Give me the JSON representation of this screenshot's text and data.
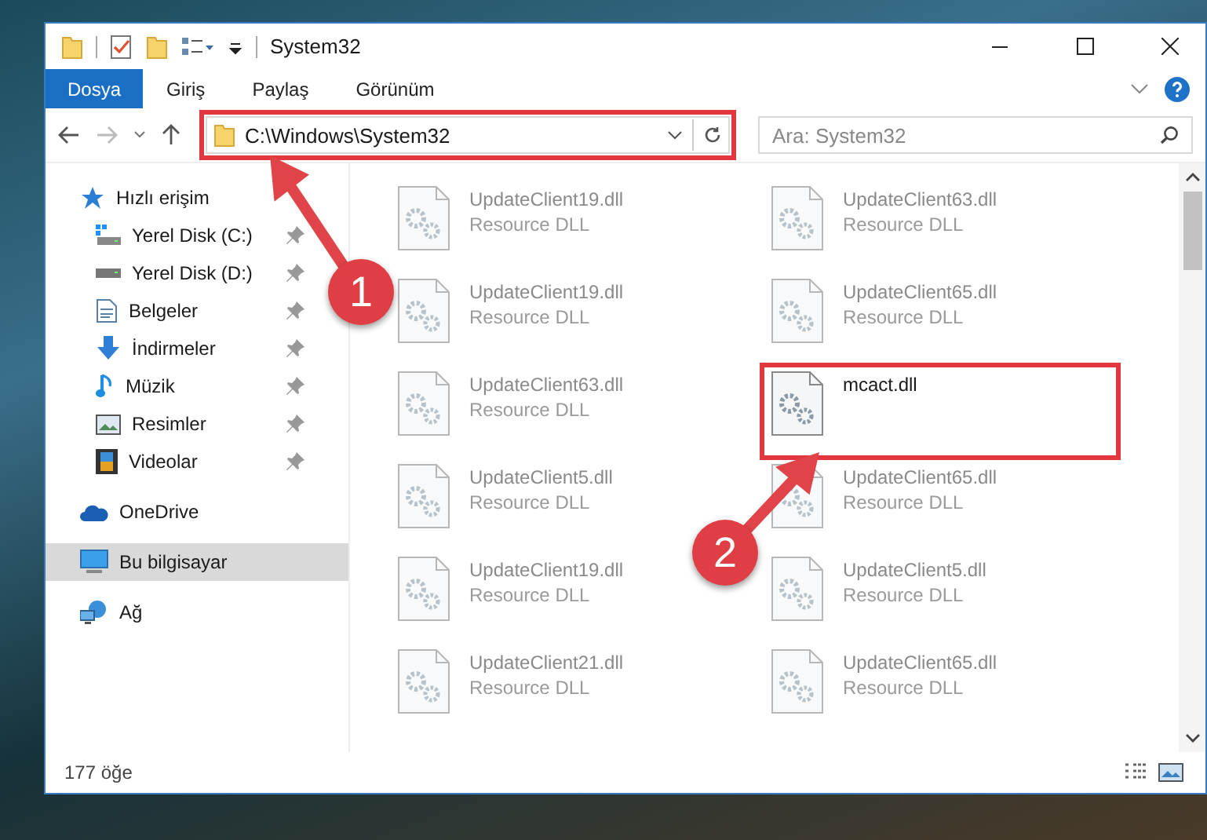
{
  "window": {
    "title": "System32"
  },
  "ribbon_tabs": [
    {
      "label": "Dosya",
      "selected": true
    },
    {
      "label": "Giriş",
      "selected": false
    },
    {
      "label": "Paylaş",
      "selected": false
    },
    {
      "label": "Görünüm",
      "selected": false
    }
  ],
  "address": {
    "path": "C:\\Windows\\System32",
    "highlighted": true
  },
  "search": {
    "placeholder": "Ara: System32"
  },
  "sidebar": {
    "items": [
      {
        "label": "Hızlı erişim",
        "kind": "star",
        "selected": false,
        "children": [
          {
            "label": "Yerel Disk (C:)",
            "kind": "drive-c",
            "pinned": true
          },
          {
            "label": "Yerel Disk (D:)",
            "kind": "drive",
            "pinned": true
          },
          {
            "label": "Belgeler",
            "kind": "docs",
            "pinned": true
          },
          {
            "label": "İndirmeler",
            "kind": "download",
            "pinned": true
          },
          {
            "label": "Müzik",
            "kind": "music",
            "pinned": true
          },
          {
            "label": "Resimler",
            "kind": "pictures",
            "pinned": true
          },
          {
            "label": "Videolar",
            "kind": "videos",
            "pinned": true
          }
        ]
      },
      {
        "label": "OneDrive",
        "kind": "cloud",
        "selected": false
      },
      {
        "label": "Bu bilgisayar",
        "kind": "pc",
        "selected": true
      },
      {
        "label": "Ağ",
        "kind": "network",
        "selected": false
      }
    ]
  },
  "files": [
    {
      "name": "UpdateClient19.dll",
      "type": "Resource DLL",
      "blurred": true,
      "highlighted": false
    },
    {
      "name": "UpdateClient63.dll",
      "type": "Resource DLL",
      "blurred": true,
      "highlighted": false
    },
    {
      "name": "UpdateClient19.dll",
      "type": "Resource DLL",
      "blurred": true,
      "highlighted": false
    },
    {
      "name": "UpdateClient65.dll",
      "type": "Resource DLL",
      "blurred": true,
      "highlighted": false
    },
    {
      "name": "UpdateClient63.dll",
      "type": "Resource DLL",
      "blurred": true,
      "highlighted": false
    },
    {
      "name": "mcact.dll",
      "blurred": false,
      "highlighted": true
    },
    {
      "name": "UpdateClient5.dll",
      "type": "Resource DLL",
      "blurred": true,
      "highlighted": false
    },
    {
      "name": "UpdateClient65.dll",
      "type": "Resource DLL",
      "blurred": true,
      "highlighted": false
    },
    {
      "name": "UpdateClient19.dll",
      "type": "Resource DLL",
      "blurred": true,
      "highlighted": false
    },
    {
      "name": "UpdateClient5.dll",
      "type": "Resource DLL",
      "blurred": true,
      "highlighted": false
    },
    {
      "name": "UpdateClient21.dll",
      "type": "Resource DLL",
      "blurred": true,
      "highlighted": false
    },
    {
      "name": "UpdateClient65.dll",
      "type": "Resource DLL",
      "blurred": true,
      "highlighted": false
    }
  ],
  "status_bar": {
    "count": "177 öğe"
  },
  "annotations": [
    {
      "label": "1"
    },
    {
      "label": "2"
    }
  ]
}
